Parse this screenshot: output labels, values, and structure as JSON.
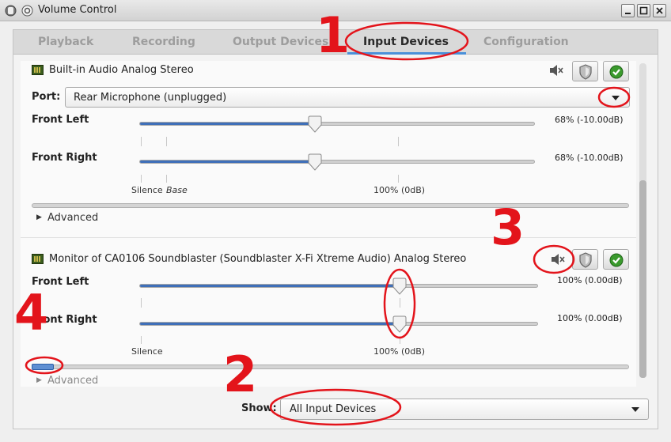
{
  "window": {
    "title": "Volume Control"
  },
  "tabs": [
    {
      "label": "Playback"
    },
    {
      "label": "Recording"
    },
    {
      "label": "Output Devices"
    },
    {
      "label": "Input Devices",
      "active": true
    },
    {
      "label": "Configuration"
    }
  ],
  "devices": [
    {
      "name": "Built-in Audio Analog Stereo",
      "port_label": "Port:",
      "port_value": "Rear Microphone (unplugged)",
      "channels": [
        {
          "label": "Front Left",
          "value_text": "68% (-10.00dB)",
          "level": 0.68
        },
        {
          "label": "Front Right",
          "value_text": "68% (-10.00dB)",
          "level": 0.68
        }
      ],
      "scale_silence": "Silence",
      "scale_base": "Base",
      "scale_100": "100% (0dB)",
      "advanced": "Advanced"
    },
    {
      "name": "Monitor of CA0106 Soundblaster (Soundblaster X-Fi Xtreme Audio) Analog Stereo",
      "channels": [
        {
          "label": "Front Left",
          "value_text": "100% (0.00dB)",
          "level": 1.0
        },
        {
          "label": "Front Right",
          "value_text": "100% (0.00dB)",
          "level": 1.0
        }
      ],
      "scale_silence": "Silence",
      "scale_100": "100% (0dB)",
      "advanced": "Advanced"
    }
  ],
  "footer": {
    "show_label": "Show:",
    "show_value": "All Input Devices"
  },
  "annotations": {
    "n1": "1",
    "n2": "2",
    "n3": "3",
    "n4": "4"
  },
  "colors": {
    "accent": "#3f6fb8",
    "annotation": "#e3141b"
  }
}
